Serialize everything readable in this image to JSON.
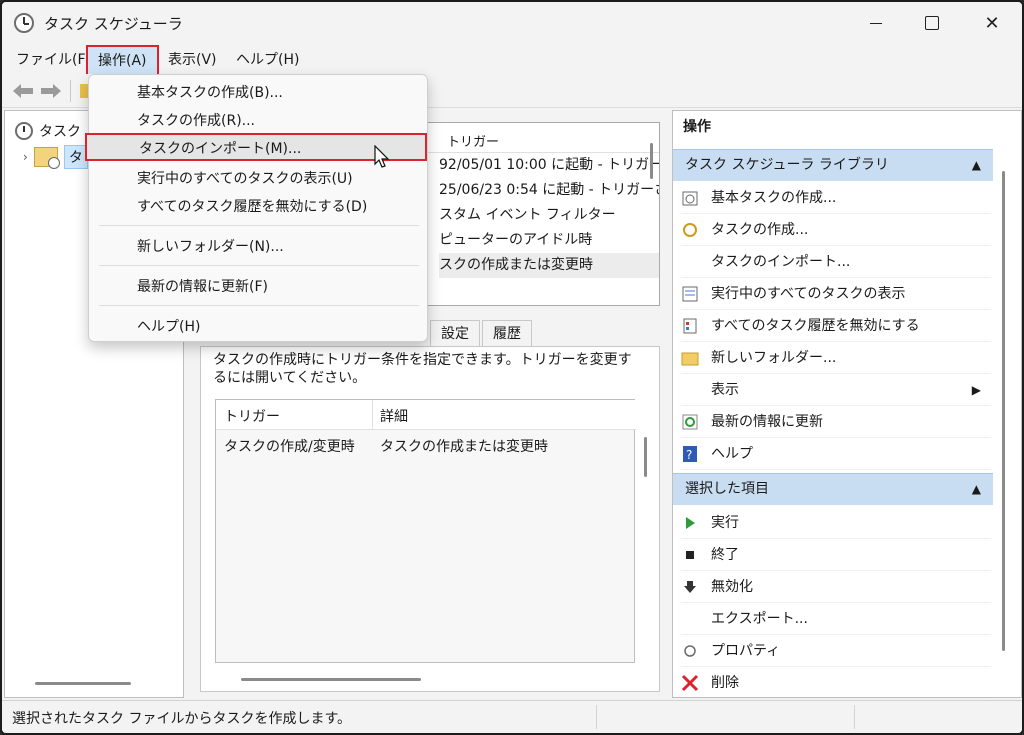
{
  "window": {
    "title": "タスク スケジューラ"
  },
  "menubar": {
    "file": "ファイル(F)",
    "action": "操作(A)",
    "view": "表示(V)",
    "help": "ヘルプ(H)"
  },
  "dropdown": {
    "items": [
      "基本タスクの作成(B)...",
      "タスクの作成(R)...",
      "タスクのインポート(M)...",
      "実行中のすべてのタスクの表示(U)",
      "すべてのタスク履歴を無効にする(D)",
      "新しいフォルダー(N)...",
      "最新の情報に更新(F)",
      "ヘルプ(H)"
    ],
    "highlighted_index": 2
  },
  "tree": {
    "root": "タスク",
    "child": "タ"
  },
  "task_list": {
    "header": "トリガー",
    "rows": [
      "92/05/01 10:00 に起動 - トリガーさ",
      "25/06/23 0:54 に起動 - トリガーされ",
      "スタム イベント フィルター",
      "ピューターのアイドル時",
      "スクの作成または変更時"
    ]
  },
  "tabs": {
    "settings": "設定",
    "history": "履歴"
  },
  "detail": {
    "description": "タスクの作成時にトリガー条件を指定できます。トリガーを変更するには開いてください。",
    "col_trigger": "トリガー",
    "col_detail": "詳細",
    "row_trigger": "タスクの作成/変更時",
    "row_detail": "タスクの作成または変更時"
  },
  "ops": {
    "title": "操作",
    "section1": "タスク スケジューラ ライブラリ",
    "section1_items": [
      "基本タスクの作成...",
      "タスクの作成...",
      "タスクのインポート...",
      "実行中のすべてのタスクの表示",
      "すべてのタスク履歴を無効にする",
      "新しいフォルダー...",
      "表示",
      "最新の情報に更新",
      "ヘルプ"
    ],
    "section2": "選択した項目",
    "section2_items": [
      "実行",
      "終了",
      "無効化",
      "エクスポート...",
      "プロパティ",
      "削除"
    ]
  },
  "status": {
    "text": "選択されたタスク ファイルからタスクを作成します。"
  },
  "colors": {
    "highlight_border": "#d9232e",
    "section_bg": "#c9ddf2"
  }
}
